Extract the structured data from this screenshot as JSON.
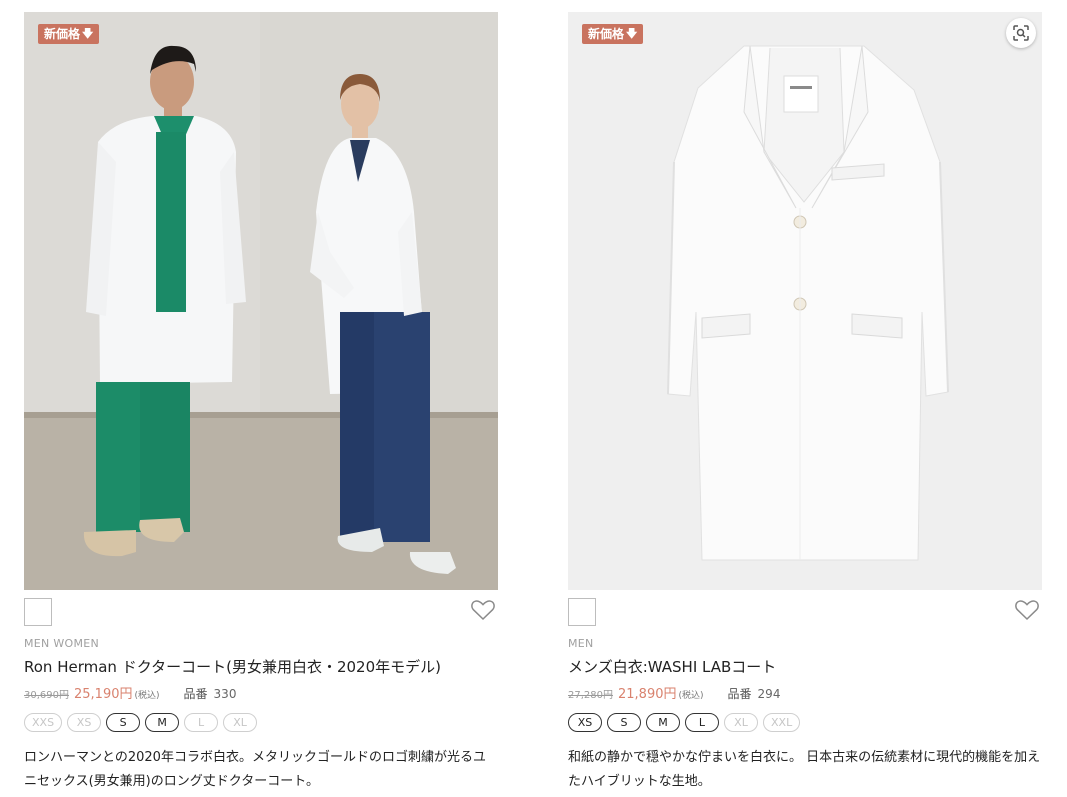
{
  "products": [
    {
      "badge": "新価格",
      "has_lens_button": false,
      "gender": "MEN WOMEN",
      "name": "Ron Herman ドクターコート(男女兼用白衣・2020年モデル)",
      "price_old": "30,690円",
      "price_new": "25,190円",
      "tax": "(税込)",
      "code_label": "品番",
      "code": "330",
      "sizes": [
        {
          "label": "XXS",
          "available": false
        },
        {
          "label": "XS",
          "available": false
        },
        {
          "label": "S",
          "available": true
        },
        {
          "label": "M",
          "available": true
        },
        {
          "label": "L",
          "available": false
        },
        {
          "label": "XL",
          "available": false
        }
      ],
      "description": "ロンハーマンとの2020年コラボ白衣。メタリックゴールドのロゴ刺繍が光るユニセックス(男女兼用)のロング丈ドクターコート。"
    },
    {
      "badge": "新価格",
      "has_lens_button": true,
      "gender": "MEN",
      "name": "メンズ白衣:WASHI LABコート",
      "price_old": "27,280円",
      "price_new": "21,890円",
      "tax": "(税込)",
      "code_label": "品番",
      "code": "294",
      "sizes": [
        {
          "label": "XS",
          "available": true
        },
        {
          "label": "S",
          "available": true
        },
        {
          "label": "M",
          "available": true
        },
        {
          "label": "L",
          "available": true
        },
        {
          "label": "XL",
          "available": false
        },
        {
          "label": "XXL",
          "available": false
        }
      ],
      "description": "和紙の静かで穏やかな佇まいを白衣に。 日本古来の伝統素材に現代的機能を加えたハイブリットな生地。"
    }
  ],
  "colors": {
    "badge": "#c9735f",
    "sale_price": "#d9826e",
    "available_border": "#333333",
    "unavailable_border": "#cfcfcf"
  },
  "icons": {
    "badge_arrow": "down-arrow-icon",
    "favorite": "heart-icon",
    "lens": "visual-search-icon"
  }
}
